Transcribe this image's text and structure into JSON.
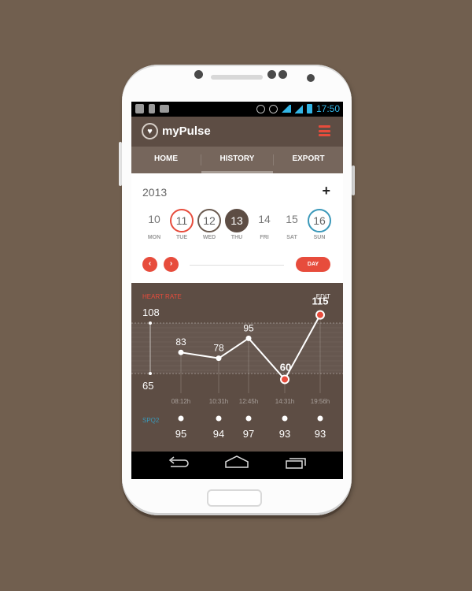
{
  "status_bar": {
    "time": "17:50"
  },
  "app": {
    "title": "myPulse"
  },
  "tabs": [
    {
      "label": "HOME",
      "active": false
    },
    {
      "label": "HISTORY",
      "active": true
    },
    {
      "label": "EXPORT",
      "active": false
    }
  ],
  "calendar": {
    "year": "2013",
    "add_label": "+",
    "days": [
      {
        "num": "10",
        "name": "MON",
        "style": "plain"
      },
      {
        "num": "11",
        "name": "TUE",
        "style": "red"
      },
      {
        "num": "12",
        "name": "WED",
        "style": "brown"
      },
      {
        "num": "13",
        "name": "THU",
        "style": "dark"
      },
      {
        "num": "14",
        "name": "FRI",
        "style": "plain"
      },
      {
        "num": "15",
        "name": "SAT",
        "style": "plain"
      },
      {
        "num": "16",
        "name": "SUN",
        "style": "blue"
      }
    ]
  },
  "range": {
    "prev_icon": "chevron-left-icon",
    "next_icon": "chevron-right-icon",
    "period_label": "DAY"
  },
  "heart_rate": {
    "title": "HEART RATE",
    "edit_label": "EDIT",
    "max_label": "108",
    "min_label": "65",
    "spo2_label": "SPQ2"
  },
  "chart_data": {
    "type": "line",
    "series": [
      {
        "name": "HEART RATE",
        "values": [
          83,
          78,
          95,
          60,
          115
        ]
      },
      {
        "name": "SPQ2",
        "values": [
          95,
          94,
          97,
          93,
          93
        ]
      }
    ],
    "x": [
      "08:12h",
      "10:31h",
      "12:45h",
      "14:31h",
      "19:56h"
    ],
    "band": [
      65,
      108
    ],
    "highlight": {
      "min_index": 3,
      "max_index": 4
    },
    "colors": {
      "line": "#ffffff",
      "accent": "#e74c3c",
      "background": "#5d4d44"
    }
  },
  "colors": {
    "accent": "#e74c3c",
    "brand": "#5d4d44",
    "status": "#33b5e5",
    "sunday": "#3a98b9"
  },
  "system_nav": {
    "back_icon": "back-icon",
    "home_icon": "home-icon",
    "recents_icon": "recents-icon"
  }
}
